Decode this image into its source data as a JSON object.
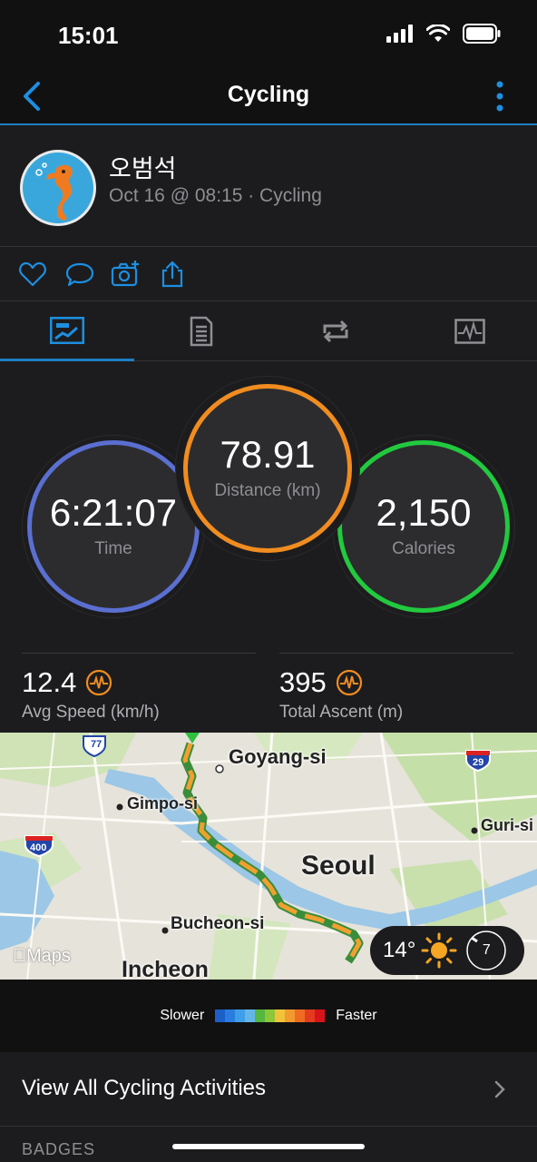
{
  "status_bar": {
    "time": "15:01"
  },
  "nav": {
    "title": "Cycling"
  },
  "profile": {
    "name": "오범석",
    "meta": "Oct 16 @ 08:15 · Cycling"
  },
  "stats": {
    "time": {
      "value": "6:21:07",
      "label": "Time"
    },
    "distance": {
      "value": "78.91",
      "label": "Distance (km)"
    },
    "calories": {
      "value": "2,150",
      "label": "Calories"
    },
    "avg_speed": {
      "value": "12.4",
      "label": "Avg Speed (km/h)"
    },
    "total_ascent": {
      "value": "395",
      "label": "Total Ascent (m)"
    }
  },
  "map": {
    "labels": {
      "goyang": "Goyang-si",
      "gimpo": "Gimpo-si",
      "seoul": "Seoul",
      "guri": "Guri-si",
      "bucheon": "Bucheon-si",
      "incheon": "Incheon"
    },
    "highway_shields": {
      "h77": "77",
      "h29": "29",
      "h400": "400"
    },
    "maps_logo": "Maps",
    "weather": {
      "temp": "14°",
      "wind": "7"
    }
  },
  "legend": {
    "slower": "Slower",
    "faster": "Faster",
    "colors": [
      "#1d5fc9",
      "#2a7de0",
      "#3f9ee8",
      "#63b6e8",
      "#55b640",
      "#8cc63a",
      "#f0c33a",
      "#f29a2e",
      "#ee6b22",
      "#e23b1e",
      "#d8141b"
    ]
  },
  "view_all": {
    "label": "View All Cycling Activities"
  },
  "badges": {
    "label": "BADGES"
  },
  "colors": {
    "accent": "#1d7fc4",
    "time_ring": "#5a6fd0",
    "distance_ring": "#f08c20",
    "calories_ring": "#22c93f"
  }
}
